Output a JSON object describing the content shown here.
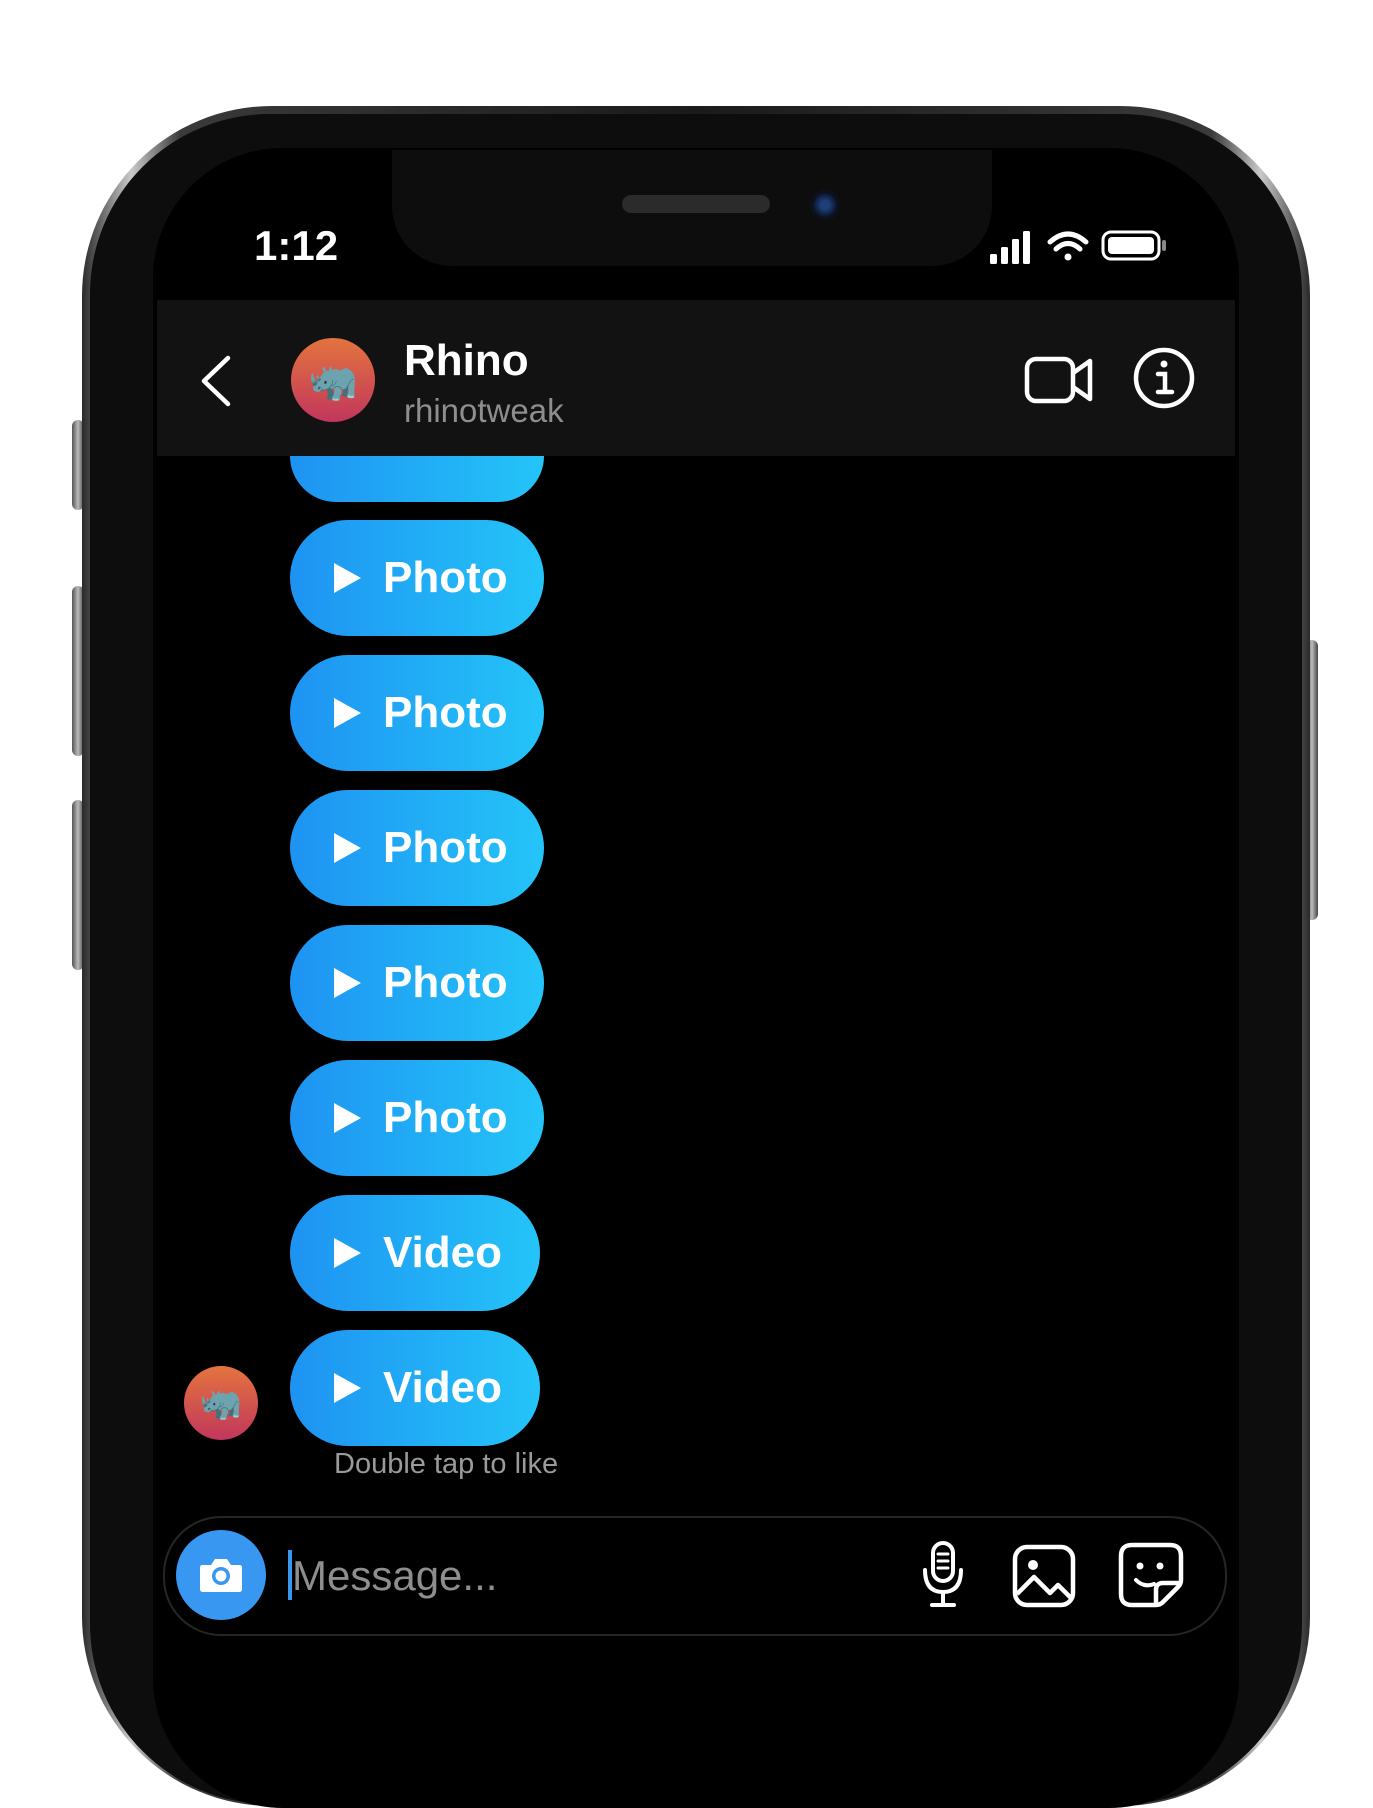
{
  "status_bar": {
    "time": "1:12",
    "icons": [
      "signal-icon",
      "wifi-icon",
      "battery-icon"
    ]
  },
  "header": {
    "back_icon": "chevron-left-icon",
    "contact_name": "Rhino",
    "contact_handle": "rhinotweak",
    "avatar_emoji": "🦏",
    "video_icon": "video-camera-icon",
    "info_icon": "info-icon"
  },
  "messages": [
    {
      "label": "Photo",
      "kind": "photo"
    },
    {
      "label": "Photo",
      "kind": "photo"
    },
    {
      "label": "Photo",
      "kind": "photo"
    },
    {
      "label": "Photo",
      "kind": "photo"
    },
    {
      "label": "Photo",
      "kind": "photo"
    },
    {
      "label": "Video",
      "kind": "video"
    },
    {
      "label": "Video",
      "kind": "video"
    }
  ],
  "hint": "Double tap to like",
  "composer": {
    "placeholder": "Message...",
    "camera_icon": "camera-icon",
    "mic_icon": "microphone-icon",
    "gallery_icon": "image-icon",
    "sticker_icon": "sticker-icon"
  },
  "colors": {
    "bubble_start": "#1e93f2",
    "bubble_end": "#24c4f8",
    "accent": "#3897f0",
    "header_bg": "#121212"
  }
}
